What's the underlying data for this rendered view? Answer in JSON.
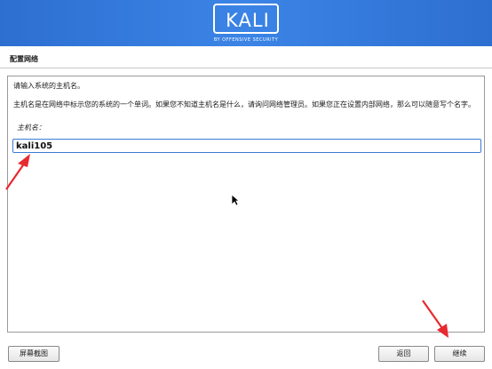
{
  "header": {
    "logo_text": "KALI",
    "logo_tagline": "BY OFFENSIVE SECURITY",
    "background_color": "#3b84e6"
  },
  "page": {
    "title": "配置网络"
  },
  "form": {
    "prompt": "请输入系统的主机名。",
    "description": "主机名是在网络中标示您的系统的一个单词。如果您不知道主机名是什么，请询问网络管理员。如果您正在设置内部网络，那么可以随意写个名字。",
    "field_label": "主机名：",
    "hostname_value": "kali105"
  },
  "buttons": {
    "screenshot": "屏幕截图",
    "back": "返回",
    "continue": "继续"
  },
  "annotations": {
    "arrow_color": "#e8292e"
  }
}
